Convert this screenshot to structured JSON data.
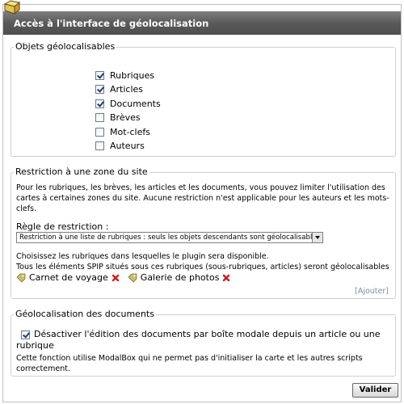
{
  "window": {
    "title": "Accès à l'interface de géolocalisation"
  },
  "objects_section": {
    "legend": "Objets géolocalisables",
    "items": [
      {
        "label": "Rubriques",
        "checked": true
      },
      {
        "label": "Articles",
        "checked": true
      },
      {
        "label": "Documents",
        "checked": true
      },
      {
        "label": "Brèves",
        "checked": false
      },
      {
        "label": "Mot-clefs",
        "checked": false
      },
      {
        "label": "Auteurs",
        "checked": false
      }
    ]
  },
  "restriction_section": {
    "legend": "Restriction à une zone du site",
    "description_line1": "Pour les rubriques, les brèves, les articles et les documents, vous pouvez limiter l'utilisation des",
    "description_line2": "cartes à certaines zones du site. Aucune restriction n'est applicable pour les auteurs et les mots-",
    "description_line3": "clefs.",
    "rule_label": "Règle de restriction :",
    "rule_value": "Restriction à une liste de rubriques : seuls les objets descendants sont géolocalisables",
    "choose_line1": "Choisissez les rubriques dans lesquelles le plugin sera disponible.",
    "choose_line2": "Tous les éléments SPIP situés sous ces rubriques (sous-rubriques, articles) seront géolocalisables",
    "rubriques": [
      "Carnet de voyage",
      "Galerie de photos"
    ],
    "add_open": "[",
    "add_label": "Ajouter",
    "add_close": "]"
  },
  "documents_section": {
    "legend": "Géolocalisation des documents",
    "checkbox_line1": "Désactiver l'édition des documents par boîte modale depuis un article ou une",
    "checkbox_line2": "rubrique",
    "checkbox_checked": true,
    "note_line1": "Cette fonction utilise ModalBox qui ne permet pas d'initialiser la carte et les autres scripts",
    "note_line2": "correctement."
  },
  "submit": {
    "label": "Valider"
  },
  "colors": {
    "titlebar": "#5a5a5a",
    "border": "#cfcfcf",
    "link": "#7a8fa8",
    "delete": "#d11a1a"
  }
}
